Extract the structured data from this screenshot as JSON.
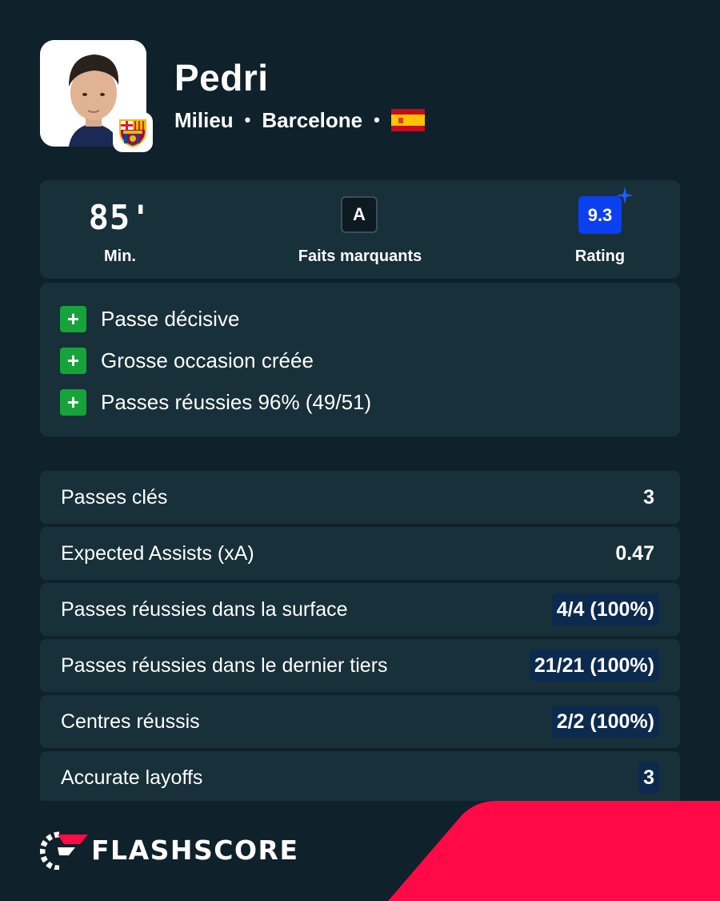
{
  "player": {
    "name": "Pedri",
    "position": "Milieu",
    "club": "Barcelone",
    "nationality_flag_icon": "spain-flag-icon",
    "club_badge_icon": "fc-barcelona-badge-icon"
  },
  "summary": {
    "minutes_value": "85'",
    "minutes_label": "Min.",
    "highlights_icon_letter": "A",
    "highlights_label": "Faits marquants",
    "rating_value": "9.3",
    "rating_label": "Rating"
  },
  "highlights": [
    {
      "icon": "plus-icon",
      "text": "Passe décisive"
    },
    {
      "icon": "plus-icon",
      "text": "Grosse occasion créée"
    },
    {
      "icon": "plus-icon",
      "text": "Passes réussies 96% (49/51)"
    }
  ],
  "stats": [
    {
      "label": "Passes clés",
      "value": "3",
      "highlighted": false
    },
    {
      "label": "Expected Assists (xA)",
      "value": "0.47",
      "highlighted": false
    },
    {
      "label": "Passes réussies dans la surface",
      "value": "4/4 (100%)",
      "highlighted": true
    },
    {
      "label": "Passes réussies dans le dernier tiers",
      "value": "21/21 (100%)",
      "highlighted": true
    },
    {
      "label": "Centres réussis",
      "value": "2/2 (100%)",
      "highlighted": true
    },
    {
      "label": "Accurate layoffs",
      "value": "3",
      "highlighted": true
    }
  ],
  "footer": {
    "brand": "FLASHSCORE",
    "logo_icon": "flashscore-logo-icon"
  },
  "colors": {
    "background": "#0f212b",
    "card": "#183039",
    "rating_blue": "#0b3ff0",
    "plus_green": "#16a33a",
    "value_highlight": "#0c2a4d",
    "brand_red": "#ff0a46"
  }
}
